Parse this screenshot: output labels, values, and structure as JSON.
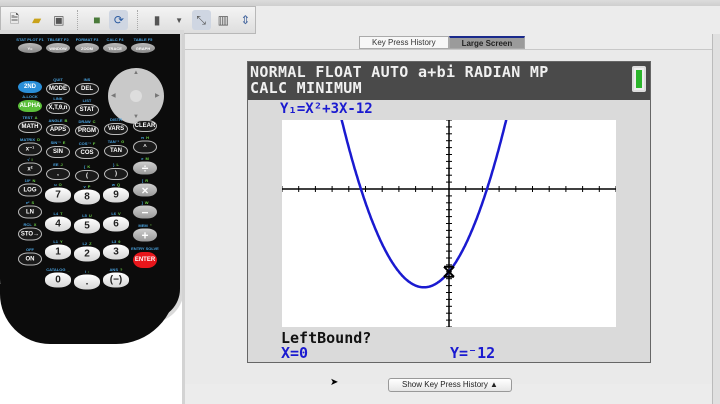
{
  "toolbar": {
    "icons": [
      "new-document-icon",
      "open-folder-icon",
      "screenshot-icon",
      "3d-cube-icon",
      "refresh-icon",
      "calculator-select-icon",
      "dropdown-icon",
      "resize-icon",
      "calculator-view-icon",
      "expand-icon"
    ]
  },
  "tabs": [
    {
      "label": "Key Press History",
      "active": false
    },
    {
      "label": "Large Screen",
      "active": true
    }
  ],
  "screen": {
    "status_line1": "NORMAL FLOAT AUTO a+bi RADIAN MP",
    "status_line2": "CALC MINIMUM",
    "function": "Y₁=X²+3X-12",
    "prompt": "LeftBound?",
    "x_readout": "X=0",
    "y_readout": "Y=⁻12",
    "battery_level": 1.0,
    "graph": {
      "coefficients": [
        1,
        3,
        -12
      ],
      "xmin": -10,
      "xmax": 10,
      "ymin": -20,
      "ymax": 10,
      "curve_color": "#1a1ad0",
      "trace_x": 0
    }
  },
  "show_history_label": "Show Key Press History ▲",
  "calculator": {
    "keys": [
      {
        "label": "Y=",
        "sec": "STAT PLOT F1"
      },
      {
        "label": "WINDOW",
        "sec": "TBLSET F2"
      },
      {
        "label": "ZOOM",
        "sec": "FORMAT F3"
      },
      {
        "label": "TRACE",
        "sec": "CALC F4"
      },
      {
        "label": "GRAPH",
        "sec": "TABLE F5"
      },
      {
        "label": "2ND",
        "sec": ""
      },
      {
        "label": "MODE",
        "sec": "QUIT"
      },
      {
        "label": "DEL",
        "sec": "INS"
      },
      {
        "label": "ALPHA",
        "sec": "A-LOCK"
      },
      {
        "label": "X,T,θ,n",
        "sec": "LINK"
      },
      {
        "label": "STAT",
        "sec": "LIST"
      },
      {
        "label": "MATH",
        "sec": "TEST",
        "alpha": "A"
      },
      {
        "label": "APPS",
        "sec": "ANGLE",
        "alpha": "B"
      },
      {
        "label": "PRGM",
        "sec": "DRAW",
        "alpha": "C"
      },
      {
        "label": "VARS",
        "sec": "DISTR"
      },
      {
        "label": "CLEAR",
        "sec": ""
      },
      {
        "label": "x⁻¹",
        "sec": "MATRIX",
        "alpha": "D"
      },
      {
        "label": "SIN",
        "sec": "SIN⁻¹",
        "alpha": "E"
      },
      {
        "label": "COS",
        "sec": "COS⁻¹",
        "alpha": "F"
      },
      {
        "label": "TAN",
        "sec": "TAN⁻¹",
        "alpha": "G"
      },
      {
        "label": "^",
        "sec": "π",
        "alpha": "H"
      },
      {
        "label": "x²",
        "sec": "√",
        "alpha": "I"
      },
      {
        "label": ",",
        "sec": "EE",
        "alpha": "J"
      },
      {
        "label": "(",
        "sec": "{",
        "alpha": "K"
      },
      {
        "label": ")",
        "sec": "}",
        "alpha": "L"
      },
      {
        "label": "÷",
        "sec": "e",
        "alpha": "M"
      },
      {
        "label": "LOG",
        "sec": "10ˣ",
        "alpha": "N"
      },
      {
        "label": "7",
        "sec": "u",
        "alpha": "O"
      },
      {
        "label": "8",
        "sec": "v",
        "alpha": "P"
      },
      {
        "label": "9",
        "sec": "w",
        "alpha": "Q"
      },
      {
        "label": "×",
        "sec": "[",
        "alpha": "R"
      },
      {
        "label": "LN",
        "sec": "eˣ",
        "alpha": "S"
      },
      {
        "label": "4",
        "sec": "L4",
        "alpha": "T"
      },
      {
        "label": "5",
        "sec": "L5",
        "alpha": "U"
      },
      {
        "label": "6",
        "sec": "L6",
        "alpha": "V"
      },
      {
        "label": "−",
        "sec": "]",
        "alpha": "W"
      },
      {
        "label": "STO→",
        "sec": "RCL",
        "alpha": "X"
      },
      {
        "label": "1",
        "sec": "L1",
        "alpha": "Y"
      },
      {
        "label": "2",
        "sec": "L2",
        "alpha": "Z"
      },
      {
        "label": "3",
        "sec": "L3",
        "alpha": "θ"
      },
      {
        "label": "+",
        "sec": "MEM",
        "alpha": "\""
      },
      {
        "label": "ON",
        "sec": "OFF"
      },
      {
        "label": "ENTER",
        "sec": "ENTRY SOLVE"
      },
      {
        "label": "0",
        "sec": "CATALOG",
        "alpha": "_"
      },
      {
        "label": ".",
        "sec": "i",
        "alpha": ":"
      },
      {
        "label": "(−)",
        "sec": "ANS",
        "alpha": "?"
      }
    ]
  }
}
